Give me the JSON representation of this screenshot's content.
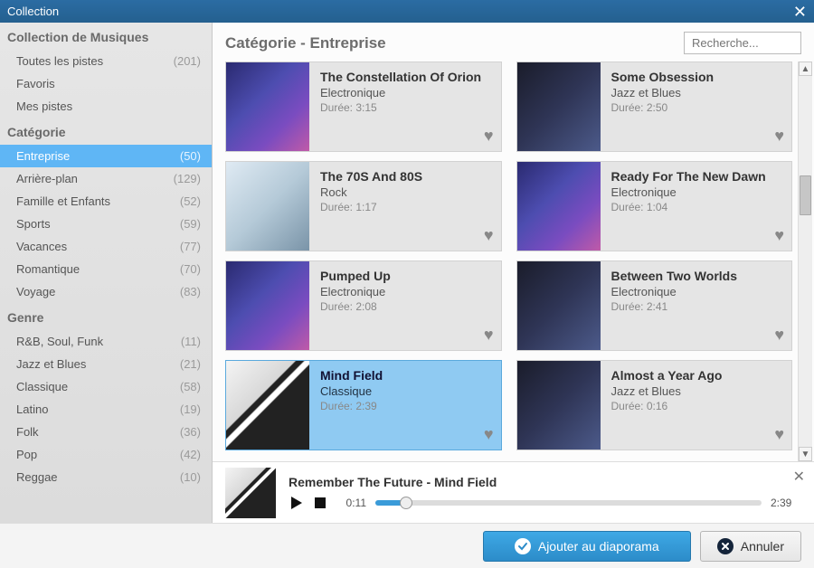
{
  "window": {
    "title": "Collection"
  },
  "search": {
    "placeholder": "Recherche..."
  },
  "content": {
    "heading": "Catégorie - Entreprise"
  },
  "sidebar": {
    "sections": [
      {
        "title": "Collection de Musiques",
        "items": [
          {
            "label": "Toutes les pistes",
            "count": "(201)"
          },
          {
            "label": "Favoris",
            "count": ""
          },
          {
            "label": "Mes pistes",
            "count": ""
          }
        ]
      },
      {
        "title": "Catégorie",
        "items": [
          {
            "label": "Entreprise",
            "count": "(50)",
            "selected": true
          },
          {
            "label": "Arrière-plan",
            "count": "(129)"
          },
          {
            "label": "Famille et Enfants",
            "count": "(52)"
          },
          {
            "label": "Sports",
            "count": "(59)"
          },
          {
            "label": "Vacances",
            "count": "(77)"
          },
          {
            "label": "Romantique",
            "count": "(70)"
          },
          {
            "label": "Voyage",
            "count": "(83)"
          }
        ]
      },
      {
        "title": "Genre",
        "items": [
          {
            "label": "R&B, Soul, Funk",
            "count": "(11)"
          },
          {
            "label": "Jazz et Blues",
            "count": "(21)"
          },
          {
            "label": "Classique",
            "count": "(58)"
          },
          {
            "label": "Latino",
            "count": "(19)"
          },
          {
            "label": "Folk",
            "count": "(36)"
          },
          {
            "label": "Pop",
            "count": "(42)"
          },
          {
            "label": "Reggae",
            "count": "(10)"
          }
        ]
      }
    ]
  },
  "tracks": [
    {
      "title": "The Constellation Of Orion",
      "genre": "Electronique",
      "duration": "Durée: 3:15",
      "art": ""
    },
    {
      "title": "Some Obsession",
      "genre": "Jazz et Blues",
      "duration": "Durée: 2:50",
      "art": "alt2"
    },
    {
      "title": "The 70S And 80S",
      "genre": "Rock",
      "duration": "Durée: 1:17",
      "art": "alt1"
    },
    {
      "title": "Ready For The New Dawn",
      "genre": "Electronique",
      "duration": "Durée: 1:04",
      "art": ""
    },
    {
      "title": "Pumped Up",
      "genre": "Electronique",
      "duration": "Durée: 2:08",
      "art": ""
    },
    {
      "title": "Between Two Worlds",
      "genre": "Electronique",
      "duration": "Durée: 2:41",
      "art": "alt2"
    },
    {
      "title": "Mind Field",
      "genre": "Classique",
      "duration": "Durée: 2:39",
      "art": "alt3",
      "selected": true
    },
    {
      "title": "Almost a Year Ago",
      "genre": "Jazz et Blues",
      "duration": "Durée: 0:16",
      "art": "alt2"
    }
  ],
  "player": {
    "title": "Remember The Future - Mind Field",
    "elapsed": "0:11",
    "total": "2:39"
  },
  "buttons": {
    "add": "Ajouter au diaporama",
    "cancel": "Annuler"
  }
}
